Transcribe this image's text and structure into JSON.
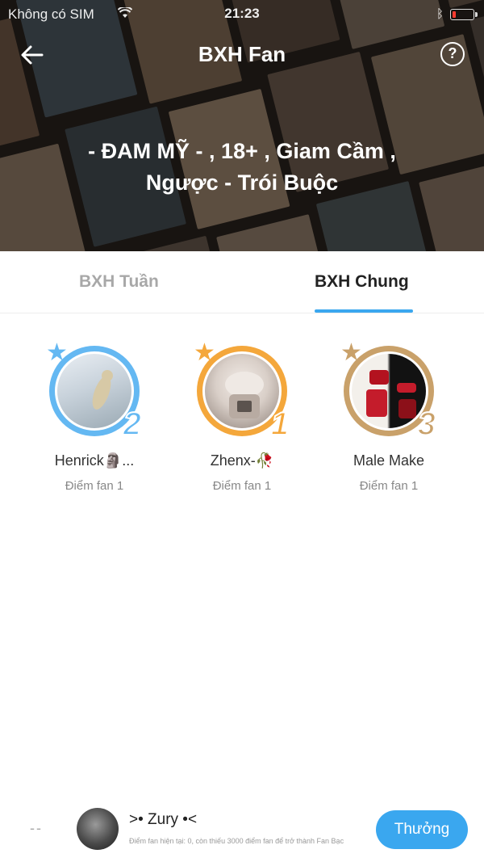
{
  "status_bar": {
    "carrier": "Không có SIM",
    "wifi_icon": "wifi-icon",
    "time": "21:23",
    "bluetooth_icon": "bluetooth-icon",
    "battery_icon": "battery-low-icon",
    "battery_color": "#ff3b30"
  },
  "header": {
    "back_icon": "arrow-left-icon",
    "title": "BXH Fan",
    "help_label": "?",
    "help_icon": "question-circle-icon",
    "book_title": "- ĐAM MỸ - , 18+ , Giam Cầm , Ngược - Trói Buộc"
  },
  "tabs": [
    {
      "label": "BXH Tuần",
      "active": false
    },
    {
      "label": "BXH Chung",
      "active": true
    }
  ],
  "podium": [
    {
      "rank": "1",
      "name": "Zhenx-🥀",
      "score": "Điểm fan 1",
      "ring_color": "#f4a73b"
    },
    {
      "rank": "2",
      "name": "Henrick🗿...",
      "score": "Điểm fan 1",
      "ring_color": "#64b8f2"
    },
    {
      "rank": "3",
      "name": "Male Make",
      "score": "Điểm fan 1",
      "ring_color": "#c9a16a"
    }
  ],
  "me": {
    "rank": "--",
    "name": ">• Zury •<",
    "note": "Điểm fan hiện tại: 0, còn thiếu 3000 điểm fan để trở thành Fan Bạc",
    "reward_label": "Thưởng"
  },
  "colors": {
    "accent": "#3aa7ef",
    "gold": "#f4a73b",
    "silver": "#64b8f2",
    "bronze": "#c9a16a"
  }
}
